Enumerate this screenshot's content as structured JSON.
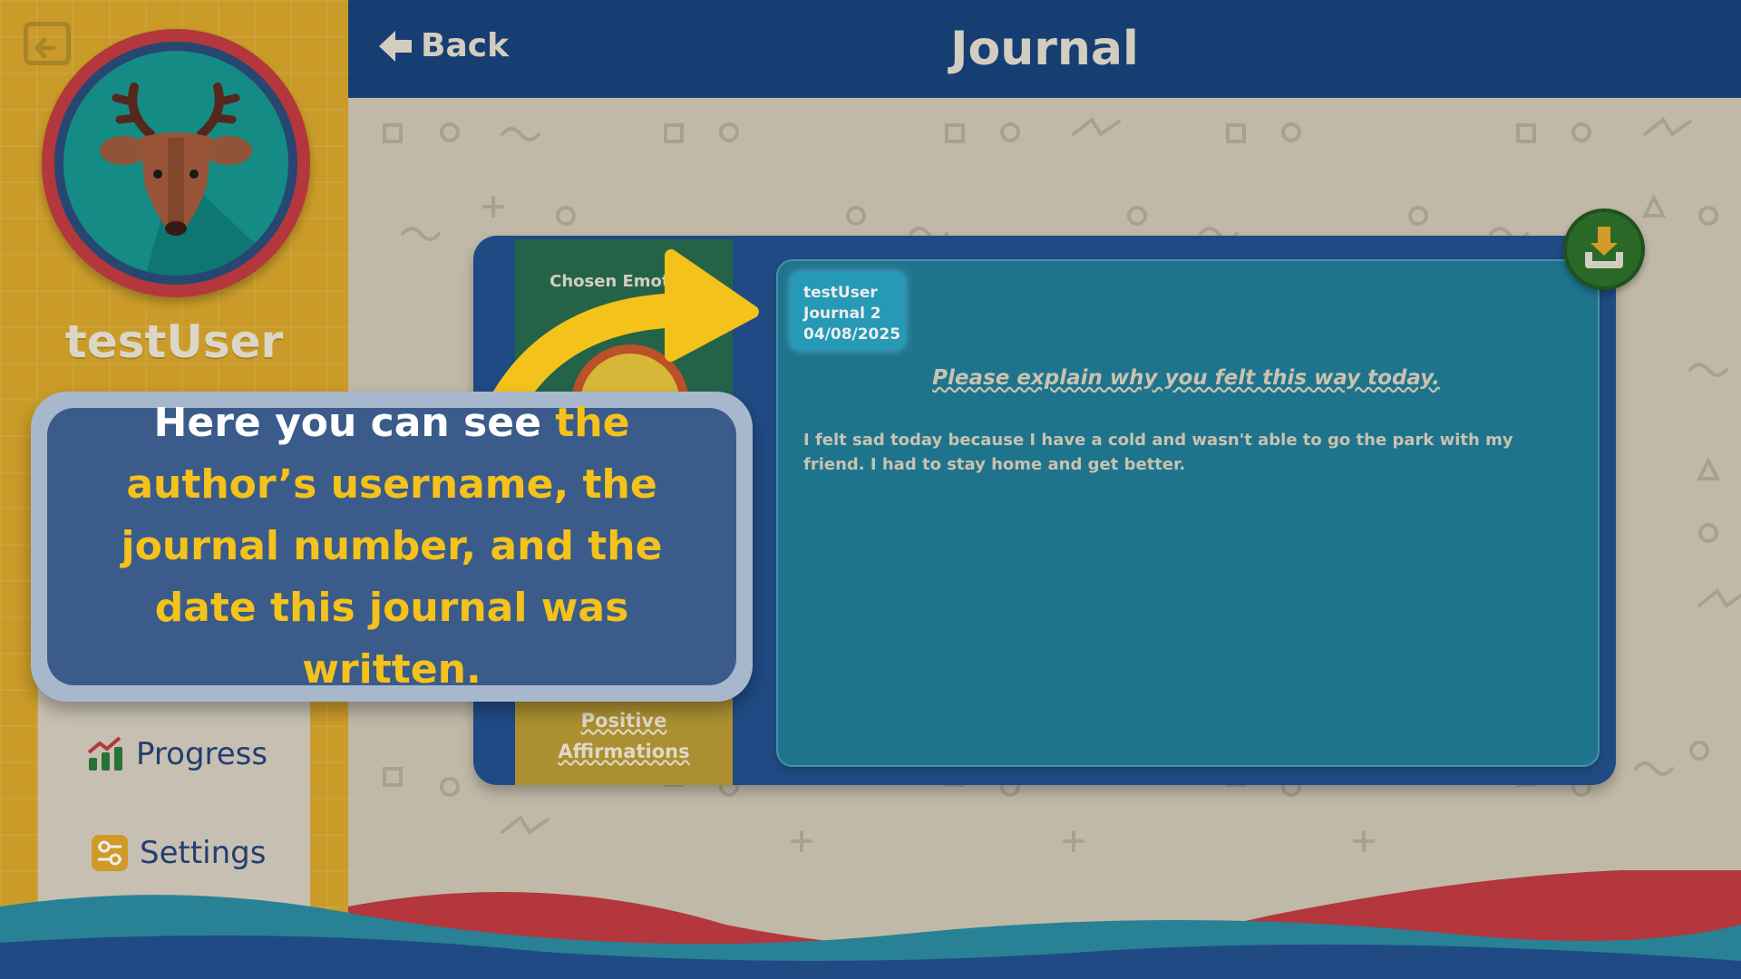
{
  "sidebar": {
    "username": "testUser",
    "nav": [
      {
        "label": "Progress",
        "icon": "chart-icon"
      },
      {
        "label": "Settings",
        "icon": "settings-icon"
      }
    ]
  },
  "header": {
    "back_label": "Back",
    "title": "Journal"
  },
  "journal": {
    "chosen_emotion_label": "Chosen Emotion",
    "positive_affirmations_label": "Positive Affirmations",
    "meta": {
      "author": "testUser",
      "journal_number": "Journal 2",
      "date": "04/08/2025"
    },
    "prompt": "Please explain why you felt this way today.",
    "entry": "I felt sad today because I have a cold and wasn't able to go the park with my friend. I had to stay home and get better."
  },
  "tutorial": {
    "text_part1": "Here you can see ",
    "text_highlight": "the author’s username, the journal number, and the date this journal was written."
  },
  "colors": {
    "sidebar": "#d9a72a",
    "topbar": "#17427a",
    "card": "#1f7c96",
    "highlight": "#f4c21a"
  }
}
